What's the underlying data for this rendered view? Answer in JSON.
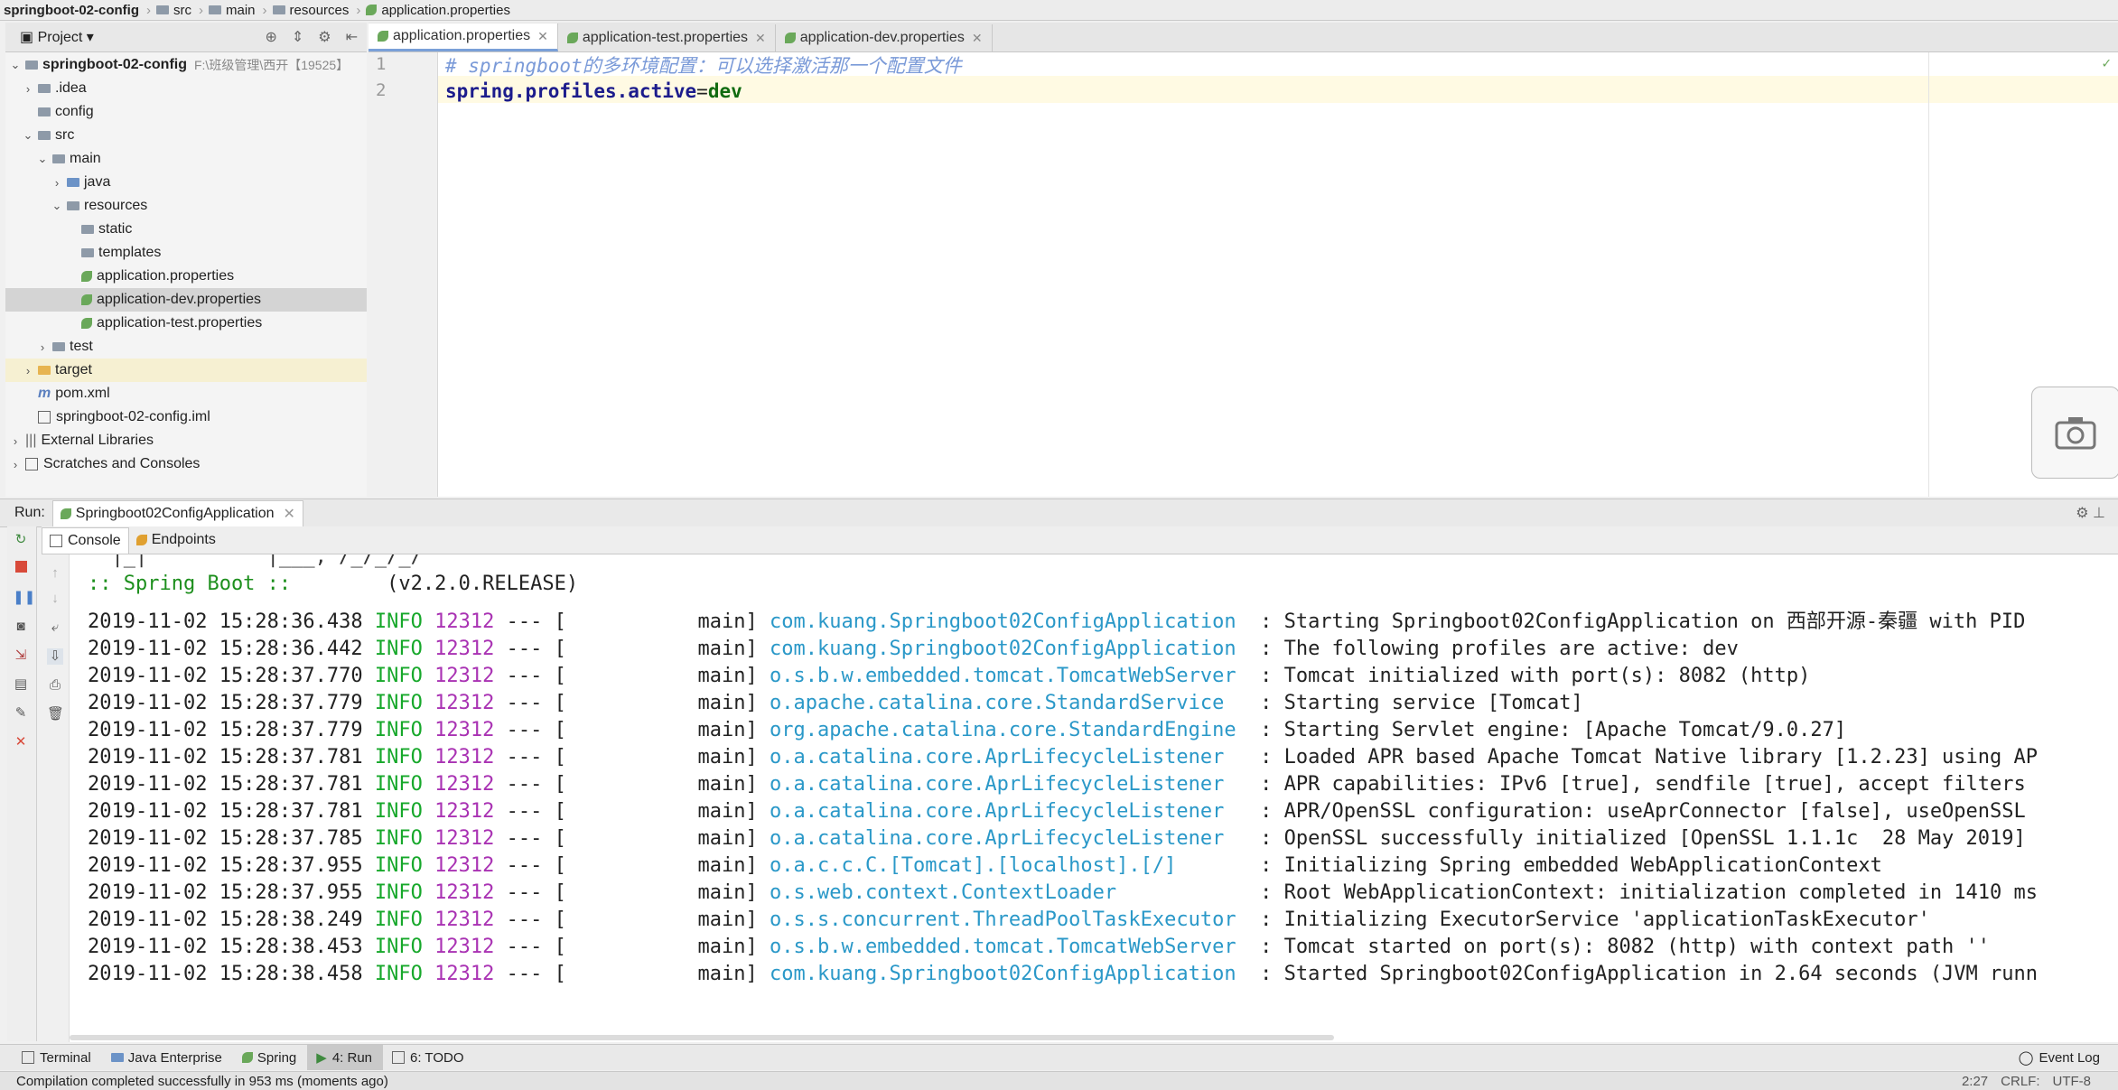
{
  "breadcrumb": [
    "springboot-02-config",
    "src",
    "main",
    "resources",
    "application.properties"
  ],
  "project_panel": {
    "title": "Project"
  },
  "tree": {
    "root": "springboot-02-config",
    "root_path": "F:\\班级管理\\西开【19525】",
    "items": [
      ".idea",
      "config",
      "src",
      "main",
      "java",
      "resources",
      "static",
      "templates",
      "application.properties",
      "application-dev.properties",
      "application-test.properties",
      "test",
      "target",
      "pom.xml",
      "springboot-02-config.iml",
      "External Libraries",
      "Scratches and Consoles"
    ]
  },
  "editor_tabs": [
    "application.properties",
    "application-test.properties",
    "application-dev.properties"
  ],
  "editor": {
    "line_numbers": [
      "1",
      "2"
    ],
    "line1_comment": "# springboot的多环境配置：可以选择激活那一个配置文件",
    "line2_key": "spring.profiles.active",
    "line2_eq": "=",
    "line2_value": "dev"
  },
  "run": {
    "label": "Run:",
    "config": "Springboot02ConfigApplication",
    "tabs": [
      "Console",
      "Endpoints"
    ]
  },
  "console": {
    "banner_art": "  |_|          |___, /_/_/_/",
    "banner_name": ":: Spring Boot ::",
    "banner_version": "(v2.2.0.RELEASE)",
    "logs": [
      {
        "ts": "2019-11-02 15:28:36.438",
        "level": "INFO",
        "pid": "12312",
        "thread": "main",
        "logger": "com.kuang.Springboot02ConfigApplication ",
        "msg": "Starting Springboot02ConfigApplication on 西部开源-秦疆 with PID"
      },
      {
        "ts": "2019-11-02 15:28:36.442",
        "level": "INFO",
        "pid": "12312",
        "thread": "main",
        "logger": "com.kuang.Springboot02ConfigApplication ",
        "msg": "The following profiles are active: dev"
      },
      {
        "ts": "2019-11-02 15:28:37.770",
        "level": "INFO",
        "pid": "12312",
        "thread": "main",
        "logger": "o.s.b.w.embedded.tomcat.TomcatWebServer ",
        "msg": "Tomcat initialized with port(s): 8082 (http)"
      },
      {
        "ts": "2019-11-02 15:28:37.779",
        "level": "INFO",
        "pid": "12312",
        "thread": "main",
        "logger": "o.apache.catalina.core.StandardService  ",
        "msg": "Starting service [Tomcat]"
      },
      {
        "ts": "2019-11-02 15:28:37.779",
        "level": "INFO",
        "pid": "12312",
        "thread": "main",
        "logger": "org.apache.catalina.core.StandardEngine ",
        "msg": "Starting Servlet engine: [Apache Tomcat/9.0.27]"
      },
      {
        "ts": "2019-11-02 15:28:37.781",
        "level": "INFO",
        "pid": "12312",
        "thread": "main",
        "logger": "o.a.catalina.core.AprLifecycleListener  ",
        "msg": "Loaded APR based Apache Tomcat Native library [1.2.23] using AP"
      },
      {
        "ts": "2019-11-02 15:28:37.781",
        "level": "INFO",
        "pid": "12312",
        "thread": "main",
        "logger": "o.a.catalina.core.AprLifecycleListener  ",
        "msg": "APR capabilities: IPv6 [true], sendfile [true], accept filters"
      },
      {
        "ts": "2019-11-02 15:28:37.781",
        "level": "INFO",
        "pid": "12312",
        "thread": "main",
        "logger": "o.a.catalina.core.AprLifecycleListener  ",
        "msg": "APR/OpenSSL configuration: useAprConnector [false], useOpenSSL"
      },
      {
        "ts": "2019-11-02 15:28:37.785",
        "level": "INFO",
        "pid": "12312",
        "thread": "main",
        "logger": "o.a.catalina.core.AprLifecycleListener  ",
        "msg": "OpenSSL successfully initialized [OpenSSL 1.1.1c  28 May 2019]"
      },
      {
        "ts": "2019-11-02 15:28:37.955",
        "level": "INFO",
        "pid": "12312",
        "thread": "main",
        "logger": "o.a.c.c.C.[Tomcat].[localhost].[/]      ",
        "msg": "Initializing Spring embedded WebApplicationContext"
      },
      {
        "ts": "2019-11-02 15:28:37.955",
        "level": "INFO",
        "pid": "12312",
        "thread": "main",
        "logger": "o.s.web.context.ContextLoader           ",
        "msg": "Root WebApplicationContext: initialization completed in 1410 ms"
      },
      {
        "ts": "2019-11-02 15:28:38.249",
        "level": "INFO",
        "pid": "12312",
        "thread": "main",
        "logger": "o.s.s.concurrent.ThreadPoolTaskExecutor ",
        "msg": "Initializing ExecutorService 'applicationTaskExecutor'"
      },
      {
        "ts": "2019-11-02 15:28:38.453",
        "level": "INFO",
        "pid": "12312",
        "thread": "main",
        "logger": "o.s.b.w.embedded.tomcat.TomcatWebServer ",
        "msg": "Tomcat started on port(s): 8082 (http) with context path ''"
      },
      {
        "ts": "2019-11-02 15:28:38.458",
        "level": "INFO",
        "pid": "12312",
        "thread": "main",
        "logger": "com.kuang.Springboot02ConfigApplication ",
        "msg": "Started Springboot02ConfigApplication in 2.64 seconds (JVM runn"
      }
    ]
  },
  "bottom_tabs": [
    "Terminal",
    "Java Enterprise",
    "Spring",
    "4: Run",
    "6: TODO"
  ],
  "event_log": "Event Log",
  "status": {
    "message": "Compilation completed successfully in 953 ms (moments ago)",
    "position": "2:27",
    "line_sep": "CRLF:",
    "encoding": "UTF-8"
  },
  "colors": {
    "info": "#17a82b",
    "pid": "#a932b3",
    "logger": "#2a98c8"
  }
}
